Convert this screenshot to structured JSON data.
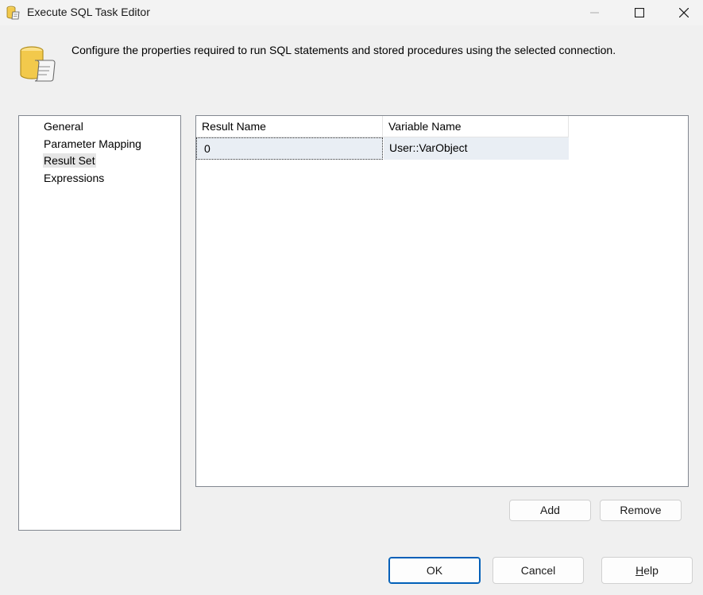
{
  "window": {
    "title": "Execute SQL Task Editor",
    "controls": [
      "minimize",
      "maximize",
      "close"
    ]
  },
  "header": {
    "description": "Configure the properties required to run SQL statements and stored procedures using the selected connection."
  },
  "nav": {
    "items": [
      {
        "label": "General",
        "selected": false
      },
      {
        "label": "Parameter Mapping",
        "selected": false
      },
      {
        "label": "Result Set",
        "selected": true
      },
      {
        "label": "Expressions",
        "selected": false
      }
    ]
  },
  "grid": {
    "columns": [
      "Result Name",
      "Variable Name"
    ],
    "rows": [
      {
        "result_name": "0",
        "variable_name": "User::VarObject"
      }
    ]
  },
  "buttons": {
    "add": "Add",
    "remove": "Remove",
    "ok": "OK",
    "cancel": "Cancel",
    "help": "Help"
  },
  "colors": {
    "accent": "#005fb8",
    "window_bg": "#f0f0f0",
    "selected_row": "#e9eef4"
  },
  "icons": {
    "app": "database-script-icon",
    "header": "database-script-icon"
  }
}
